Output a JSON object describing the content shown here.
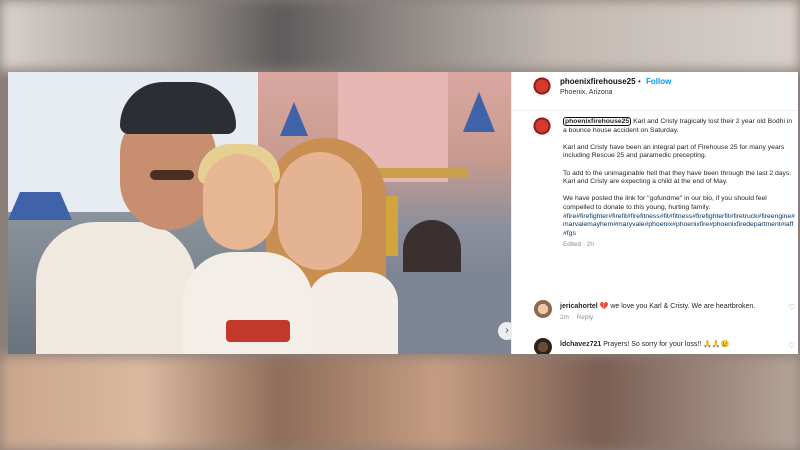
{
  "post": {
    "username": "phoenixfirehouse25",
    "follow_label": "Follow",
    "separator": "•",
    "location": "Phoenix, Arizona",
    "caption": {
      "user_tag": "phoenixfirehouse25",
      "p1": "Karl and Cristy tragically lost their 2 year old Bodhi in a bounce house accident on Saturday.",
      "p2": "Karl and Cristy have been an integral part of Firehouse 25 for many years including Rescue 25 and paramedic precepting.",
      "p3": "To add to the unimaginable hell that they have been through the last 2 days. Karl and Cristy are expecting a child at the end of May.",
      "p4": "We have posted the link for \"gofundme\" in our bio, if you should feel compelled to donate to this young, hurting family.",
      "hashtags": "#fire#firefighter#firefit#firefitness#fit#fitness#firefighterfit#firetruck#fireengine#marvalemayhem#maryvale#phoenix#phoenixfire#phoenixfiredepartment#iaff#fgs",
      "meta": "Edited · 2h"
    },
    "photo_next_label": "›"
  },
  "comments": [
    {
      "username": "jericahortel",
      "text": "💔 we love you Karl & Cristy. We are heartbroken.",
      "time": "2m",
      "reply_label": "Reply"
    },
    {
      "username": "ldchavez721",
      "text": "Prayers! So sorry for your loss!! 🙏🙏😢"
    }
  ],
  "icons": {
    "heart": "♡"
  }
}
